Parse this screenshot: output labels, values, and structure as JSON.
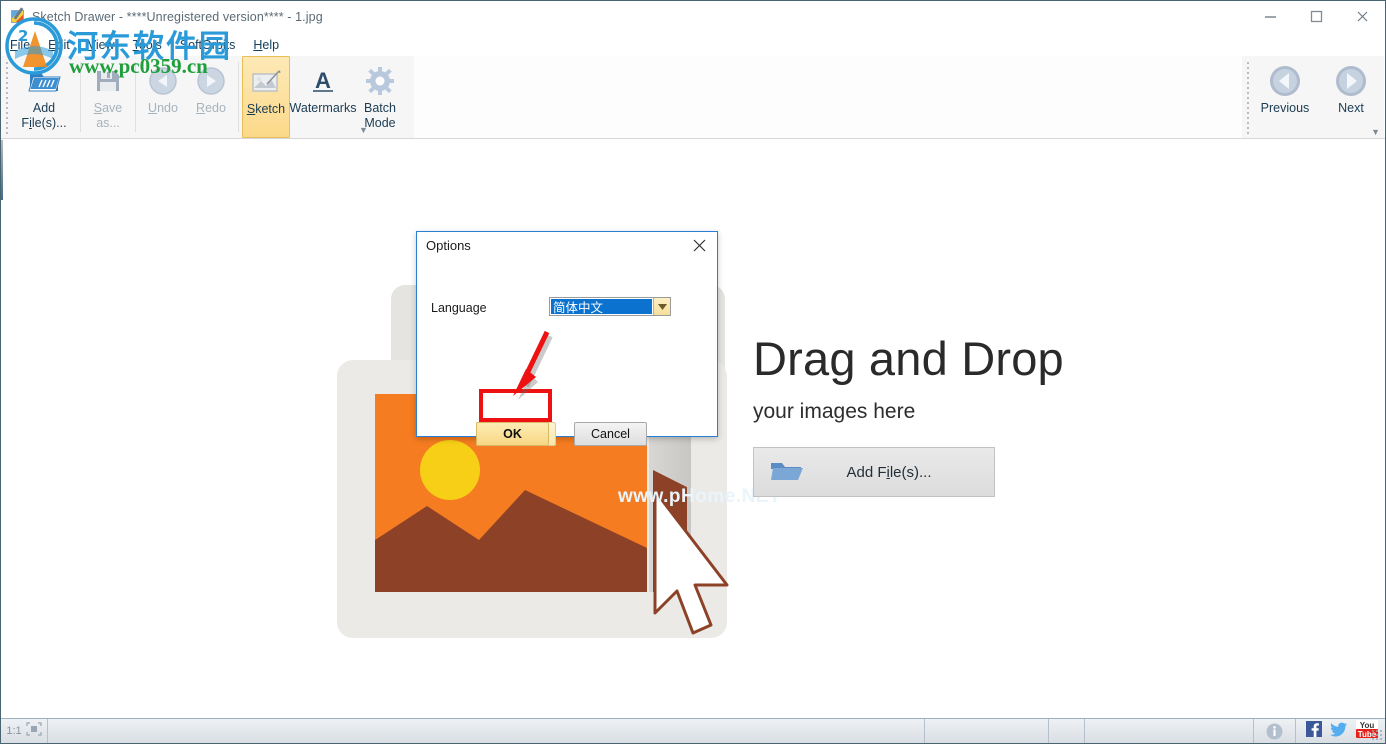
{
  "window": {
    "title": "Sketch Drawer - ****Unregistered version**** - 1.jpg",
    "app_icon": "sketch-drawer-icon",
    "controls": {
      "minimize": "minimize",
      "maximize": "maximize",
      "close": "close"
    }
  },
  "menubar": {
    "items": [
      {
        "id": "file",
        "label": "File",
        "mnemonic": "F"
      },
      {
        "id": "edit",
        "label": "Edit",
        "mnemonic": "E"
      },
      {
        "id": "view",
        "label": "View",
        "mnemonic": "V"
      },
      {
        "id": "tools",
        "label": "Tools",
        "mnemonic": "T"
      },
      {
        "id": "softorbits",
        "label": "SoftOrbits",
        "mnemonic": ""
      },
      {
        "id": "help",
        "label": "Help",
        "mnemonic": "H"
      }
    ]
  },
  "ribbon": {
    "add_files": {
      "line1": "Add",
      "line2": "File(s)...",
      "icon": "open-folder-icon",
      "enabled": true
    },
    "save_as": {
      "line1": "Save",
      "line2": "as...",
      "icon": "floppy-disk-icon",
      "enabled": false
    },
    "undo": {
      "label": "Undo",
      "icon": "undo-arrow-icon",
      "enabled": false
    },
    "redo": {
      "label": "Redo",
      "icon": "redo-arrow-icon",
      "enabled": false
    },
    "sketch": {
      "label": "Sketch",
      "icon": "sketch-picture-icon",
      "active": true
    },
    "watermarks": {
      "label": "Watermarks",
      "icon": "letter-a-icon",
      "active": false
    },
    "batch_mode": {
      "line1": "Batch",
      "line2": "Mode",
      "icon": "gear-icon",
      "active": false
    },
    "previous": {
      "label": "Previous",
      "icon": "previous-circle-icon"
    },
    "next": {
      "label": "Next",
      "icon": "next-circle-icon"
    },
    "collapse": "collapse-ribbon-arrow"
  },
  "canvas": {
    "drop_title": "Drag and Drop",
    "drop_subtitle": "your images here",
    "add_files_button": {
      "label": "Add File(s)...",
      "mnemonic": "i",
      "icon": "folder-icon"
    },
    "illustration": "drag-drop-image-illustration",
    "faint_watermark": "www.pHome.NET"
  },
  "site_watermark": {
    "name_cn": "河东软件园",
    "url": "www.pc0359.cn",
    "logo": "site-logo-icon"
  },
  "statusbar": {
    "zoom_ratio": "1:1",
    "fit_icon": "fit-to-window-icon",
    "info_icon": "info-icon",
    "social": [
      {
        "id": "facebook",
        "name": "facebook-icon",
        "glyph": "f",
        "color": "#3b5998"
      },
      {
        "id": "twitter",
        "name": "twitter-icon",
        "glyph": "t",
        "color": "#55acee"
      },
      {
        "id": "youtube",
        "name": "youtube-icon",
        "line1": "You",
        "line2": "Tube",
        "color": "#e62117"
      }
    ],
    "resize_grip": "resize-grip"
  },
  "dialog": {
    "title": "Options",
    "close_icon": "close-icon",
    "language_label": "Language",
    "language_value": "简体中文",
    "language_dropdown_icon": "chevron-down-icon",
    "ok_label": "OK",
    "cancel_label": "Cancel",
    "highlight_color": "#ee1111",
    "arrow_annotation": "red-arrow-pointing-to-ok"
  }
}
